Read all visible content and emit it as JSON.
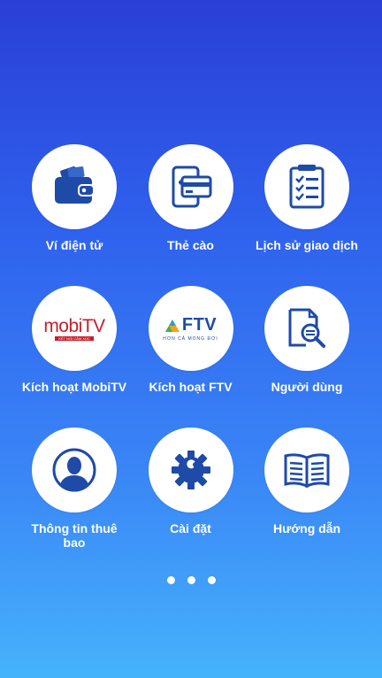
{
  "colors": {
    "icon_blue": "#1e4aa8",
    "mobitv_red": "#c41f2a",
    "tile_bg": "#ffffff"
  },
  "menu": [
    {
      "label": "Ví điện tử",
      "icon": "wallet-icon"
    },
    {
      "label": "Thẻ cào",
      "icon": "scratch-card-icon"
    },
    {
      "label": "Lịch sử giao dịch",
      "icon": "checklist-icon"
    },
    {
      "label": "Kích hoạt MobiTV",
      "icon": "mobitv-logo"
    },
    {
      "label": "Kích hoạt FTV",
      "icon": "ftv-logo"
    },
    {
      "label": "Người dùng",
      "icon": "document-search-icon"
    },
    {
      "label": "Thông tin thuê bao",
      "icon": "user-profile-icon"
    },
    {
      "label": "Cài đặt",
      "icon": "gear-wrench-icon"
    },
    {
      "label": "Hướng dẫn",
      "icon": "open-book-icon"
    }
  ],
  "logos": {
    "mobitv": {
      "word": "mobiTV",
      "tagline": "KẾT NỐI CẢM XÚC"
    },
    "ftv": {
      "word": "FTV",
      "tagline": "HƠN CẢ MONG ĐỢI"
    }
  },
  "pager": {
    "pages": 3,
    "current": 1
  }
}
